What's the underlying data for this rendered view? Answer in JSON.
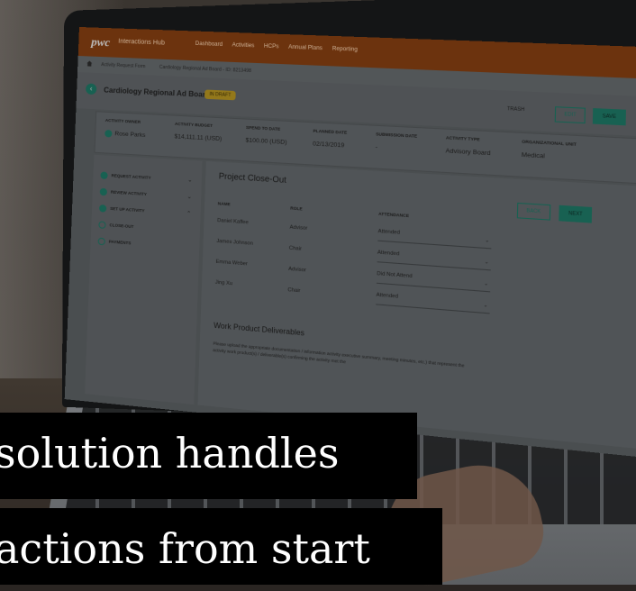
{
  "app": {
    "logo": "pwc",
    "name": "Interactions Hub",
    "nav": [
      "Dashboard",
      "Activities",
      "HCPs",
      "Annual Plans",
      "Reporting"
    ],
    "avatar": "MW"
  },
  "breadcrumb": {
    "item1": "Activity Request Form",
    "item2": "Cardiology Regional Ad Board - ID: 8213498"
  },
  "header": {
    "title": "Cardiology Regional Ad Board",
    "status": "IN DRAFT",
    "trash": "TRASH",
    "edit": "EDIT",
    "save": "SAVE"
  },
  "summary": {
    "owner_label": "ACTIVITY OWNER",
    "owner_value": "Rose Parks",
    "budget_label": "ACTIVITY BUDGET",
    "budget_value": "$14,111.11 (USD)",
    "spend_label": "SPEND TO DATE",
    "spend_value": "$100.00 (USD)",
    "planned_label": "PLANNED DATE",
    "planned_value": "02/13/2019",
    "submission_label": "SUBMISSION DATE",
    "submission_value": "-",
    "type_label": "ACTIVITY TYPE",
    "type_value": "Advisory Board",
    "unit_label": "ORGANIZATIONAL UNIT",
    "unit_value": "Medical"
  },
  "steps": [
    "REQUEST ACTIVITY",
    "REVIEW ACTIVITY",
    "SET UP ACTIVITY",
    "CLOSE-OUT",
    "PAYMENTS"
  ],
  "closeout": {
    "title": "Project Close-Out",
    "back": "BACK",
    "next": "NEXT",
    "col_name": "NAME",
    "col_role": "ROLE",
    "col_attendance": "ATTENDANCE",
    "rows": [
      {
        "name": "Daniel Kaffee",
        "role": "Advisor",
        "attendance": "Attended"
      },
      {
        "name": "James Johnson",
        "role": "Chair",
        "attendance": "Attended"
      },
      {
        "name": "Emma Weber",
        "role": "Advisor",
        "attendance": "Did Not Attend"
      },
      {
        "name": "Jing Xu",
        "role": "Chair",
        "attendance": "Attended"
      }
    ]
  },
  "deliverables": {
    "title": "Work Product Deliverables",
    "text": "Please upload the appropriate documentation / information activity executive summary, meeting minutes, etc.) that represent the activity work product(s) / deliverable(s) confirming the activity met the"
  },
  "caption": {
    "line1": "solution handles",
    "line2": "actions from start"
  }
}
